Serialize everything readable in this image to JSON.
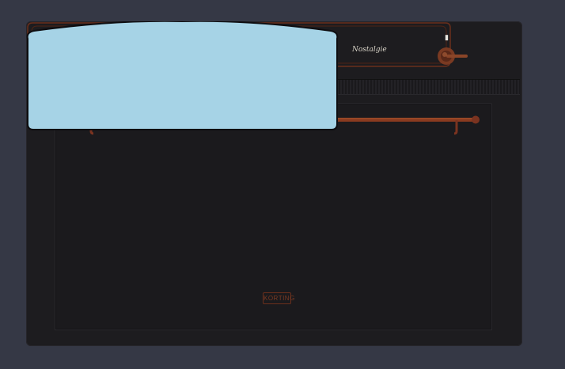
{
  "appliance": {
    "type": "built-in oven",
    "color": "#1d1c1f",
    "trim_color": "#8a3a1f",
    "glass_color": "#a6d3e6"
  },
  "control_panel": {
    "script_label": "Nostalgie",
    "left_knob_symbol": "Ī",
    "right_knob_symbol": "▮",
    "display_left_symbol": "▬",
    "display_mid_symbol": "=",
    "display_right_symbol": "⊏"
  },
  "door": {
    "brand_label": "KORTING"
  }
}
